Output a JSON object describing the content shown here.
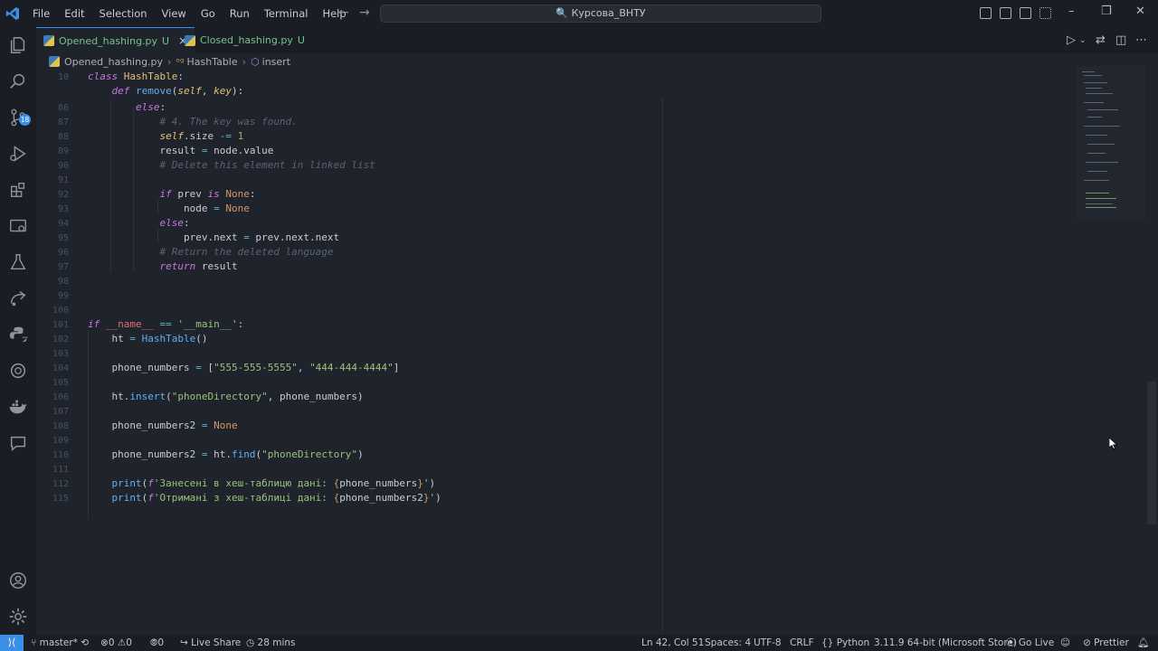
{
  "menu": [
    "File",
    "Edit",
    "Selection",
    "View",
    "Go",
    "Run",
    "Terminal",
    "Help"
  ],
  "search": "🔍 Курсова_ВНТУ",
  "tabs": [
    {
      "label": "Opened_hashing.py",
      "status": "U",
      "close": "×"
    },
    {
      "label": "Closed_hashing.py",
      "status": "U"
    }
  ],
  "breadcrumbs": [
    "Opened_hashing.py",
    "HashTable",
    "insert"
  ],
  "scm_badge": "18",
  "code_lines": [
    {
      "n": "10",
      "i": 0
    },
    {
      "n": "",
      "i": 1
    },
    {
      "n": "86",
      "i": 2
    },
    {
      "n": "87",
      "i": 3
    },
    {
      "n": "88",
      "i": 3
    },
    {
      "n": "89",
      "i": 3
    },
    {
      "n": "90",
      "i": 3
    },
    {
      "n": "91",
      "i": 3
    },
    {
      "n": "92",
      "i": 3
    },
    {
      "n": "93",
      "i": 3
    },
    {
      "n": "94",
      "i": 4
    },
    {
      "n": "95",
      "i": 3
    },
    {
      "n": "96",
      "i": 4
    },
    {
      "n": "97",
      "i": 3
    },
    {
      "n": "98",
      "i": 3
    },
    {
      "n": "99",
      "i": 0
    },
    {
      "n": "100",
      "i": 0
    },
    {
      "n": "101",
      "i": 0
    },
    {
      "n": "102",
      "i": 0
    },
    {
      "n": "103",
      "i": 1
    },
    {
      "n": "104",
      "i": 1
    },
    {
      "n": "105",
      "i": 1
    },
    {
      "n": "106",
      "i": 1
    },
    {
      "n": "107",
      "i": 1
    },
    {
      "n": "108",
      "i": 1
    },
    {
      "n": "109",
      "i": 1
    },
    {
      "n": "110",
      "i": 1
    },
    {
      "n": "111",
      "i": 1
    },
    {
      "n": "112",
      "i": 1
    }
  ],
  "status": {
    "branch": "master*",
    "errors": "0",
    "warnings": "0",
    "ports": "0",
    "live_share": "Live Share",
    "time": "28 mins",
    "position": "Ln 42, Col 51",
    "spaces": "Spaces: 4",
    "encoding": "UTF-8",
    "eol": "CRLF",
    "language": "Python",
    "interpreter": "3.11.9 64-bit (Microsoft Store)",
    "go_live": "Go Live",
    "prettier": "Prettier"
  },
  "colors": {
    "accent": "#3b8fe6",
    "untracked": "#77c48a",
    "keyword": "#c678dd",
    "string": "#98c379",
    "function": "#61afef"
  }
}
